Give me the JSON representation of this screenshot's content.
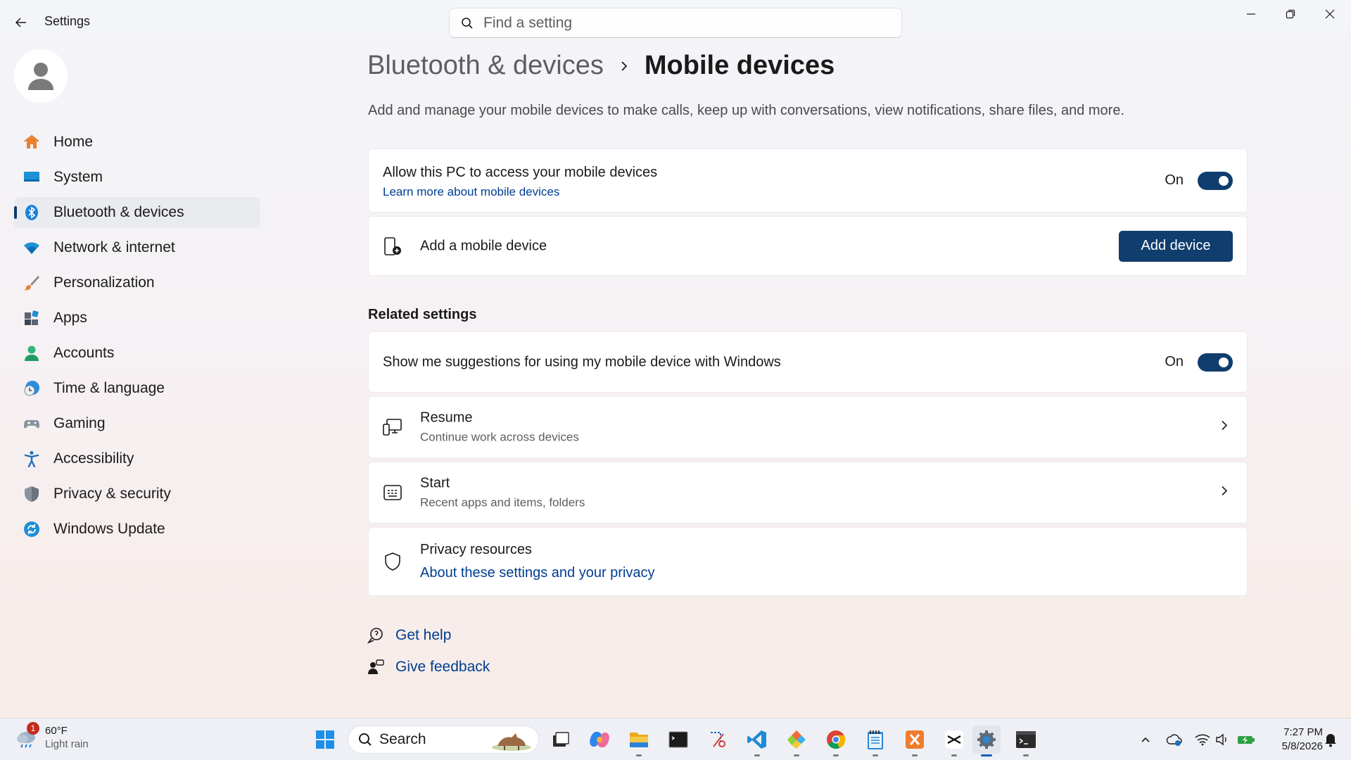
{
  "window": {
    "title": "Settings"
  },
  "search": {
    "placeholder": "Find a setting"
  },
  "sidebar": {
    "items": [
      {
        "label": "Home",
        "icon": "home-icon"
      },
      {
        "label": "System",
        "icon": "system-icon"
      },
      {
        "label": "Bluetooth & devices",
        "icon": "bluetooth-icon",
        "active": true
      },
      {
        "label": "Network & internet",
        "icon": "wifi-icon"
      },
      {
        "label": "Personalization",
        "icon": "brush-icon"
      },
      {
        "label": "Apps",
        "icon": "apps-icon"
      },
      {
        "label": "Accounts",
        "icon": "accounts-icon"
      },
      {
        "label": "Time & language",
        "icon": "clock-globe-icon"
      },
      {
        "label": "Gaming",
        "icon": "gamepad-icon"
      },
      {
        "label": "Accessibility",
        "icon": "accessibility-icon"
      },
      {
        "label": "Privacy & security",
        "icon": "shield-icon"
      },
      {
        "label": "Windows Update",
        "icon": "update-icon"
      }
    ]
  },
  "breadcrumb": {
    "parent": "Bluetooth & devices",
    "current": "Mobile devices"
  },
  "description": "Add and manage your mobile devices to make calls, keep up with conversations, view notifications, share files, and more.",
  "access_card": {
    "title": "Allow this PC to access your mobile devices",
    "link": "Learn more about mobile devices",
    "toggle_label": "On"
  },
  "add_card": {
    "title": "Add a mobile device",
    "button": "Add device"
  },
  "related": {
    "heading": "Related settings",
    "suggestions": {
      "title": "Show me suggestions for using my mobile device with Windows",
      "toggle_label": "On"
    },
    "resume": {
      "title": "Resume",
      "subtitle": "Continue work across devices"
    },
    "start": {
      "title": "Start",
      "subtitle": "Recent apps and items, folders"
    },
    "privacy": {
      "title": "Privacy resources",
      "link": "About these settings and your privacy"
    }
  },
  "help": {
    "get_help": "Get help",
    "feedback": "Give feedback"
  },
  "taskbar": {
    "weather": {
      "temp": "60°F",
      "condition": "Light rain",
      "badge": "1"
    },
    "search_label": "Search",
    "clock": {
      "time": "7:27 PM",
      "date": "5/8/2026"
    }
  },
  "colors": {
    "accent": "#0f3d6e",
    "link": "#003e92"
  }
}
